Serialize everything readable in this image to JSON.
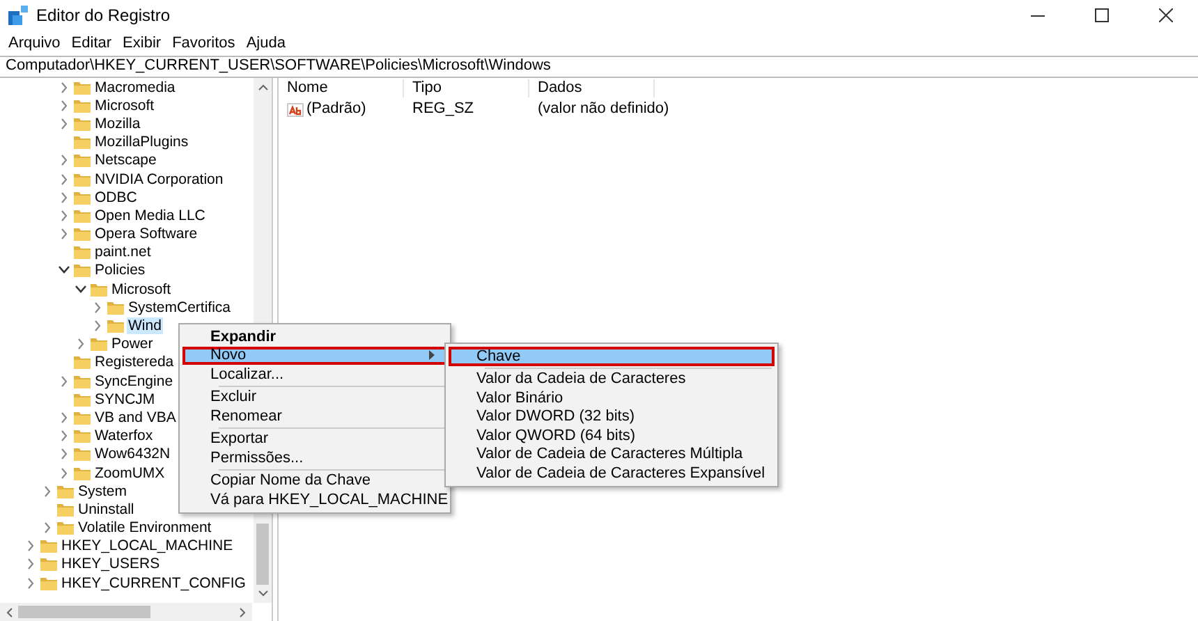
{
  "window": {
    "title": "Editor do Registro"
  },
  "menu_bar": [
    "Arquivo",
    "Editar",
    "Exibir",
    "Favoritos",
    "Ajuda"
  ],
  "address": "Computador\\HKEY_CURRENT_USER\\SOFTWARE\\Policies\\Microsoft\\Windows",
  "tree": {
    "items": [
      {
        "children": [
          {
            "children": [
              {
                "label": "Macromedia",
                "expanded": false,
                "selected": false
              },
              {
                "label": "Microsoft",
                "expanded": false,
                "selected": false
              },
              {
                "label": "Mozilla",
                "expanded": false,
                "selected": false
              },
              {
                "label": "MozillaPlugins",
                "selected": false
              },
              {
                "label": "Netscape",
                "expanded": false,
                "selected": false
              },
              {
                "label": "NVIDIA Corporation",
                "expanded": false,
                "selected": false
              },
              {
                "label": "ODBC",
                "expanded": false,
                "selected": false
              },
              {
                "label": "Open Media LLC",
                "expanded": false,
                "selected": false
              },
              {
                "label": "Opera Software",
                "expanded": false,
                "selected": false
              },
              {
                "label": "paint.net",
                "selected": false
              },
              {
                "label": "Policies",
                "expanded": true,
                "selected": false,
                "children": [
                  {
                    "label": "Microsoft",
                    "expanded": true,
                    "selected": false,
                    "children": [
                      {
                        "label": "SystemCertifica",
                        "expanded": false,
                        "selected": false
                      },
                      {
                        "label": "Wind",
                        "expanded": false,
                        "selected": true
                      }
                    ]
                  },
                  {
                    "label": "Power",
                    "expanded": false,
                    "selected": false
                  }
                ]
              },
              {
                "label": "Registereda",
                "selected": false
              },
              {
                "label": "SyncEngine",
                "expanded": false,
                "selected": false
              },
              {
                "label": "SYNCJM",
                "selected": false
              },
              {
                "label": "VB and VBA",
                "expanded": false,
                "selected": false
              },
              {
                "label": "Waterfox",
                "expanded": false,
                "selected": false
              },
              {
                "label": "Wow6432N",
                "expanded": false,
                "selected": false
              },
              {
                "label": "ZoomUMX",
                "expanded": false,
                "selected": false
              }
            ]
          },
          {
            "label": "System",
            "expanded": false,
            "selected": false
          },
          {
            "label": "Uninstall",
            "selected": false
          },
          {
            "label": "Volatile Environment",
            "expanded": false,
            "selected": false
          }
        ]
      },
      {
        "label": "HKEY_LOCAL_MACHINE",
        "expanded": false,
        "selected": false
      },
      {
        "label": "HKEY_USERS",
        "expanded": false,
        "selected": false
      },
      {
        "label": "HKEY_CURRENT_CONFIG",
        "expanded": false,
        "selected": false
      }
    ]
  },
  "values": {
    "columns": [
      "Nome",
      "Tipo",
      "Dados"
    ],
    "rows": [
      {
        "name": "(Padrão)",
        "type": "REG_SZ",
        "data": "(valor não definido)"
      }
    ]
  },
  "context_menu": {
    "items": [
      {
        "kind": "item",
        "label": "Expandir",
        "bold": true,
        "selected": false,
        "outlined": false
      },
      {
        "kind": "item",
        "label": "Novo",
        "bold": false,
        "selected": true,
        "outlined": true,
        "submenu": true
      },
      {
        "kind": "item",
        "label": "Localizar...",
        "bold": false,
        "selected": false,
        "outlined": false
      },
      {
        "kind": "separator"
      },
      {
        "kind": "item",
        "label": "Excluir",
        "bold": false,
        "selected": false,
        "outlined": false
      },
      {
        "kind": "item",
        "label": "Renomear",
        "bold": false,
        "selected": false,
        "outlined": false
      },
      {
        "kind": "separator"
      },
      {
        "kind": "item",
        "label": "Exportar",
        "bold": false,
        "selected": false,
        "outlined": false
      },
      {
        "kind": "item",
        "label": "Permissões...",
        "bold": false,
        "selected": false,
        "outlined": false
      },
      {
        "kind": "separator"
      },
      {
        "kind": "item",
        "label": "Copiar Nome da Chave",
        "bold": false,
        "selected": false,
        "outlined": false
      },
      {
        "kind": "item",
        "label": "Vá para HKEY_LOCAL_MACHINE",
        "bold": false,
        "selected": false,
        "outlined": false
      }
    ]
  },
  "submenu": {
    "items": [
      {
        "kind": "item",
        "label": "Chave",
        "selected": true,
        "outlined": true
      },
      {
        "kind": "separator"
      },
      {
        "kind": "item",
        "label": "Valor da Cadeia de Caracteres",
        "selected": false,
        "outlined": false
      },
      {
        "kind": "item",
        "label": "Valor Binário",
        "selected": false,
        "outlined": false
      },
      {
        "kind": "item",
        "label": "Valor DWORD (32 bits)",
        "selected": false,
        "outlined": false
      },
      {
        "kind": "item",
        "label": "Valor QWORD (64 bits)",
        "selected": false,
        "outlined": false
      },
      {
        "kind": "item",
        "label": "Valor de Cadeia de Caracteres Múltipla",
        "selected": false,
        "outlined": false
      },
      {
        "kind": "item",
        "label": "Valor de Cadeia de Caracteres Expansível",
        "selected": false,
        "outlined": false
      }
    ]
  }
}
